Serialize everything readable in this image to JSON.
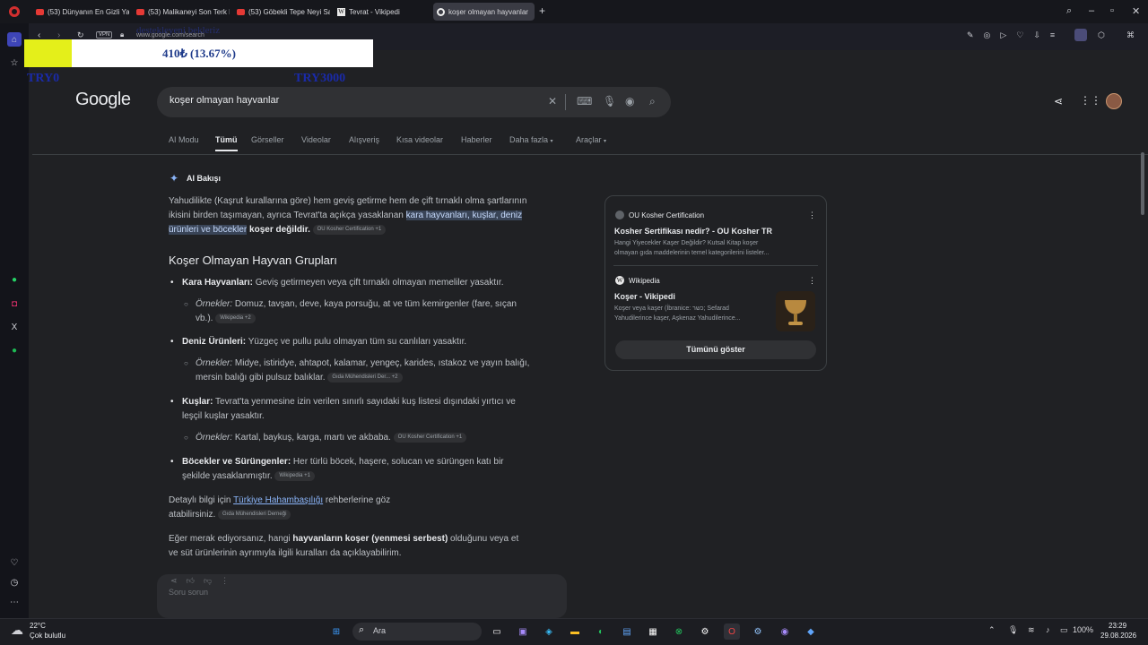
{
  "tabs": [
    {
      "label": "(53) Dünyanın En Gizli Yar",
      "icon": "youtube-icon"
    },
    {
      "label": "(53) Malikaneyi Son Terk E",
      "icon": "youtube-icon"
    },
    {
      "label": "(53) Göbekli Tepe Neyi Sa",
      "icon": "youtube-icon"
    },
    {
      "label": "Tevrat - Vikipedi",
      "icon": "wikipedia-icon"
    },
    {
      "label": "koşer olmayan hayvanlar",
      "icon": "google-icon"
    }
  ],
  "address": {
    "url": "www.google.com/search",
    "vpn": "VPN"
  },
  "overlay": {
    "amount": "410₺ (13.67%)",
    "left_label": "TRY0",
    "right_label": "TRY3000",
    "top_label": "destekleyeni bekleriz"
  },
  "google": {
    "logo": "Google",
    "query": "koşer olmayan hayvanlar",
    "nav": [
      "AI Modu",
      "Tümü",
      "Görseller",
      "Videolar",
      "Alışveriş",
      "Kısa videolar",
      "Haberler",
      "Daha fazla",
      "Araçlar"
    ]
  },
  "ai": {
    "badge": "AI Bakışı",
    "intro_1": "Yahudilikte (Kaşrut kurallarına göre) hem geviş getirme hem de çift tırnaklı olma şartlarının",
    "intro_2a": "ikisini birden taşımayan, ayrıca Tevrat'ta açıkça yasaklanan ",
    "intro_2b": "kara hayvanları, kuşlar, deniz",
    "intro_3a": "ürünleri ve böcekler",
    "intro_3b": " koşer değildir.",
    "intro_chip": "OU Kosher Certification +1",
    "heading": "Koşer Olmayan Hayvan Grupları",
    "groups": [
      {
        "title": "Kara Hayvanları:",
        "text": " Geviş getirmeyen veya çift tırnaklı olmayan memeliler yasaktır.",
        "ex_label": "Örnekler:",
        "ex_1": " Domuz, tavşan, deve, kaya porsuğu, at ve tüm kemirgenler (fare, sıçan",
        "ex_2": "vb.).",
        "chip": "Wikipedia +2"
      },
      {
        "title": "Deniz Ürünleri:",
        "text": " Yüzgeç ve pullu pulu olmayan tüm su canlıları yasaktır.",
        "ex_label": "Örnekler:",
        "ex_1": " Midye, istiridye, ahtapot, kalamar, yengeç, karides, ıstakoz ve yayın balığı,",
        "ex_2": "mersin balığı gibi pulsuz balıklar.",
        "chip": "Gıda Mühendisleri Der... +2"
      },
      {
        "title": "Kuşlar:",
        "text": " Tevrat'ta yenmesine izin verilen sınırlı sayıdaki kuş listesi dışındaki yırtıcı ve",
        "text_2": "leşçil kuşlar yasaktır.",
        "ex_label": "Örnekler:",
        "ex_1": " Kartal, baykuş, karga, martı ve akbaba.",
        "chip": "OU Kosher Certification +1"
      },
      {
        "title": "Böcekler ve Sürüngenler:",
        "text": " Her türlü böcek, haşere, solucan ve sürüngen katı bir",
        "text_2": "şekilde yasaklanmıştır.",
        "chip": "Wikipedia +1"
      }
    ],
    "detail_a": "Detaylı bilgi için ",
    "detail_link": "Türkiye Hahambaşılığı",
    "detail_b": " rehberlerine göz",
    "detail_2": "atabilirsiniz.",
    "detail_chip": "Gıda Mühendisleri Derneği",
    "closing_a": "Eğer merak ediyorsanız, hangi ",
    "closing_b": "hayvanların koşer (yenmesi serbest)",
    "closing_c": " olduğunu veya et",
    "closing_2": "ve süt ürünlerinin ayrımıyla ilgili kuralları da açıklayabilirim.",
    "ask_placeholder": "Soru sorun"
  },
  "sources": [
    {
      "site": "OU Kosher Certification",
      "title": "Kosher Sertifikası nedir? - OU Kosher TR",
      "snippet_1": "Hangi Yiyecekler Kaşer Değildir? Kutsal Kitap koşer",
      "snippet_2": "olmayan gıda maddelerinin temel kategorilerini listeler..."
    },
    {
      "site": "Wikipedia",
      "title": "Koşer - Vikipedi",
      "snippet_1": "Koşer veya kaşer (İbranice: כשר; Sefarad",
      "snippet_2": "Yahudilerince kaşer, Aşkenaz Yahudilerince..."
    }
  ],
  "show_all": "Tümünü göster",
  "taskbar": {
    "weather_temp": "22°C",
    "weather_desc": "Çok bulutlu",
    "search": "Ara",
    "battery": "100%",
    "time": "23:29",
    "date": "29.08.2026"
  }
}
